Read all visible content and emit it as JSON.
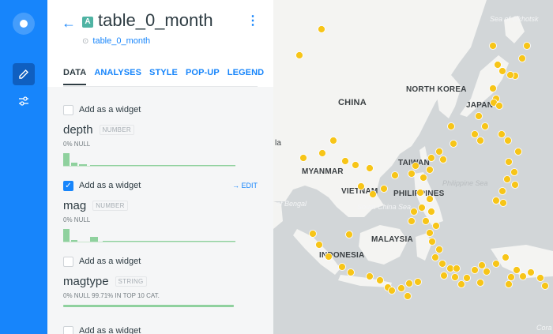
{
  "rail": {
    "icons": [
      "logo-icon",
      "pencil-icon",
      "sliders-icon"
    ]
  },
  "header": {
    "badge": "A",
    "title": "table_0_month",
    "source": "table_0_month"
  },
  "tabs": [
    "DATA",
    "ANALYSES",
    "STYLE",
    "POP-UP",
    "LEGEND"
  ],
  "fields": [
    {
      "widget_label": "Add as a widget",
      "name": "depth",
      "type": "NUMBER",
      "meta": "0% NULL",
      "checked": false,
      "edit": ""
    },
    {
      "widget_label": "Add as a widget",
      "name": "mag",
      "type": "NUMBER",
      "meta": "0% NULL",
      "checked": true,
      "edit": "EDIT"
    },
    {
      "widget_label": "Add as a widget",
      "name": "magtype",
      "type": "STRING",
      "meta": "0% NULL   99.71% IN TOP 10 CAT.",
      "checked": false,
      "edit": ""
    },
    {
      "widget_label": "Add as a widget"
    }
  ],
  "map_labels": {
    "sea_okhotsk": "Sea of Okhotsk",
    "north_korea": "NORTH KOREA",
    "japan": "JAPAN",
    "china": "CHINA",
    "myanmar": "MYANMAR",
    "taiwan": "TAIWAN",
    "philippine_sea": "Philippine Sea",
    "vietnam": "VIETNAM",
    "philippines": "PHILIPPINES",
    "bay_bengal": "of Bengal",
    "south_china_sea": "South China Sea",
    "malaysia": "MALAYSIA",
    "indonesia": "INDONESIA",
    "cora": "Cora",
    "la": "la"
  },
  "colors": {
    "brand": "#1785fb",
    "points": "#f7c518",
    "histogram": "#8fd19e"
  }
}
